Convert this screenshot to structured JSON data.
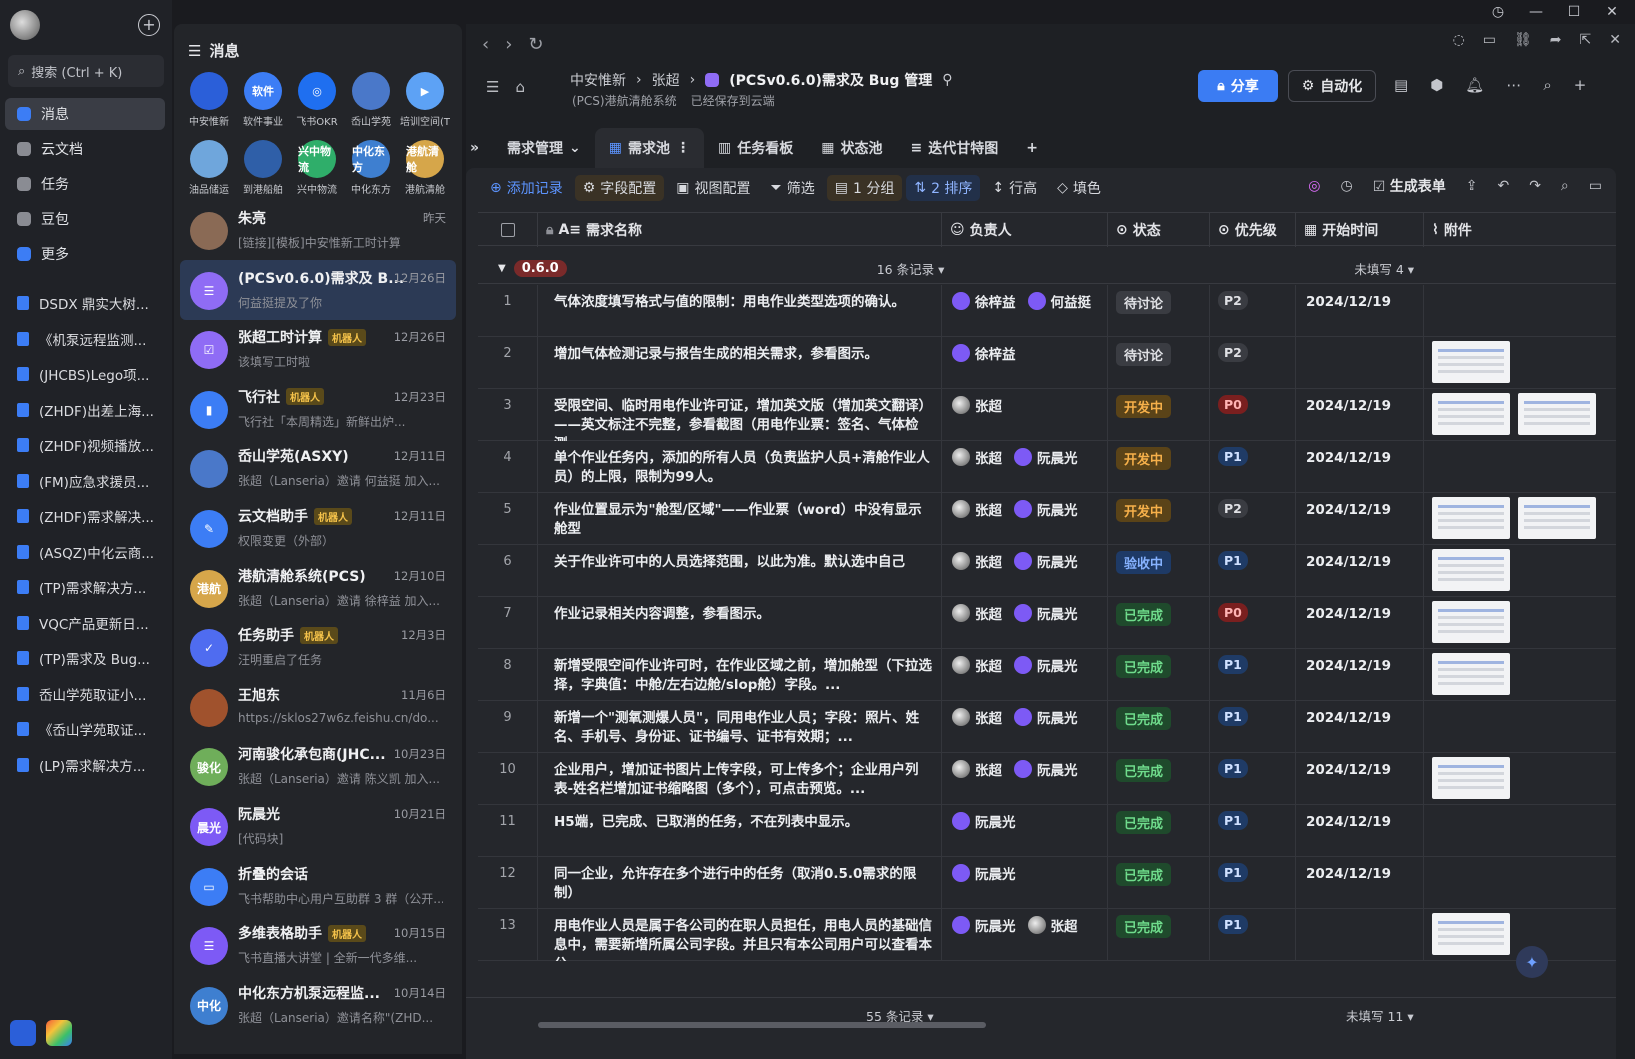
{
  "window_controls": [
    "◷",
    "—",
    "☐",
    "✕"
  ],
  "rail": {
    "search_placeholder": "搜索 (Ctrl + K)",
    "nav": [
      {
        "label": "消息",
        "color": "#3c7df5"
      },
      {
        "label": "云文档",
        "color": "#8a8c93"
      },
      {
        "label": "任务",
        "color": "#8a8c93"
      },
      {
        "label": "豆包",
        "color": "#8a8c93"
      },
      {
        "label": "更多",
        "color": "#3c7df5"
      }
    ],
    "docs": [
      "DSDX 鼎实大树...",
      "《机泵远程监测...",
      "(JHCBS)Lego项...",
      "(ZHDF)出差上海...",
      "(ZHDF)视频播放...",
      "(FM)应急求援员...",
      "(ZHDF)需求解决...",
      "(ASQZ)中化云商...",
      "(TP)需求解决方...",
      "VQC产品更新日...",
      "(TP)需求及 Bug...",
      "岙山学苑取证小...",
      "《岙山学苑取证...",
      "(LP)需求解决方..."
    ]
  },
  "messages": {
    "title": "消息",
    "apps": [
      {
        "label": "中安惟新",
        "text": "",
        "color": "#2b5fd9"
      },
      {
        "label": "软件事业",
        "text": "软件",
        "color": "#3c7df5"
      },
      {
        "label": "飞书OKR",
        "text": "◎",
        "color": "#1f6ff0"
      },
      {
        "label": "岙山学苑",
        "text": "",
        "color": "#4a78c9"
      },
      {
        "label": "培训空间(T",
        "text": "▶",
        "color": "#5da2f5"
      },
      {
        "label": "油品储运",
        "text": "",
        "color": "#6fa6dc"
      },
      {
        "label": "到港船舶",
        "text": "",
        "color": "#2f5fa8"
      },
      {
        "label": "兴中物流",
        "text": "兴中物流",
        "color": "#2fae6a"
      },
      {
        "label": "中化东方",
        "text": "中化东方",
        "color": "#3e7fd0"
      },
      {
        "label": "港航清舱",
        "text": "港航清舱",
        "color": "#d6a64a"
      }
    ],
    "conversations": [
      {
        "title": "朱亮",
        "bot": false,
        "time": "昨天",
        "sub": "[链接][模板]中安惟新工时计算",
        "avatar": "",
        "color": "#8a6a55"
      },
      {
        "title": "(PCSv0.6.0)需求及 B...",
        "bot": false,
        "time": "12月26日",
        "sub": "何益挺提及了你",
        "avatar": "☰",
        "color": "#8f6cf5"
      },
      {
        "title": "张超工时计算",
        "bot": true,
        "time": "12月26日",
        "sub": "该填写工时啦",
        "avatar": "☑",
        "color": "#8f6cf5"
      },
      {
        "title": "飞行社",
        "bot": true,
        "time": "12月23日",
        "sub": "飞行社「本周精选」新鲜出炉...",
        "avatar": "▮",
        "color": "#3c7df5"
      },
      {
        "title": "岙山学苑(ASXY)",
        "bot": false,
        "time": "12月11日",
        "sub": "张超（Lanseria）邀请 何益挺 加入...",
        "avatar": "",
        "color": "#4a78c9"
      },
      {
        "title": "云文档助手",
        "bot": true,
        "time": "12月11日",
        "sub": "权限变更（外部）",
        "avatar": "✎",
        "color": "#3c7df5"
      },
      {
        "title": "港航清舱系统(PCS)",
        "bot": false,
        "time": "12月10日",
        "sub": "张超（Lanseria）邀请 徐梓益 加入...",
        "avatar": "港航",
        "color": "#d6a64a"
      },
      {
        "title": "任务助手",
        "bot": true,
        "time": "12月3日",
        "sub": "汪明重启了任务",
        "avatar": "✓",
        "color": "#4f6cf0"
      },
      {
        "title": "王旭东",
        "bot": false,
        "time": "11月6日",
        "sub": "https://sklos27w6z.feishu.cn/do...",
        "avatar": "",
        "color": "#a0522d"
      },
      {
        "title": "河南骏化承包商(JHC...",
        "bot": false,
        "time": "10月23日",
        "sub": "张超（Lanseria）邀请 陈义凯 加入...",
        "avatar": "骏化",
        "color": "#6fae5a"
      },
      {
        "title": "阮晨光",
        "bot": false,
        "time": "10月21日",
        "sub": "[代码块]",
        "avatar": "晨光",
        "color": "#7d5af5"
      },
      {
        "title": "折叠的会话",
        "bot": false,
        "time": "",
        "sub": "飞书帮助中心用户互助群 3 群（公开...",
        "avatar": "▭",
        "color": "#3c7df5"
      },
      {
        "title": "多维表格助手",
        "bot": true,
        "time": "10月15日",
        "sub": "飞书直播大讲堂 | 全新一代多维...",
        "avatar": "☰",
        "color": "#7d5af5"
      },
      {
        "title": "中化东方机泵远程监...",
        "bot": false,
        "time": "10月14日",
        "sub": "张超（Lanseria）邀请名称\"(ZHD...",
        "avatar": "中化",
        "color": "#3e7fd0"
      }
    ]
  },
  "main": {
    "breadcrumb": [
      "中安惟新",
      "张超",
      "(PCSv0.6.0)需求及 Bug 管理"
    ],
    "sub_breadcrumb": [
      "(PCS)港航清舱系统",
      "已经保存到云端"
    ],
    "share": "分享",
    "automation": "自动化",
    "tabs": [
      "需求管理",
      "需求池",
      "任务看板",
      "状态池",
      "迭代甘特图"
    ],
    "toolbar": [
      "添加记录",
      "字段配置",
      "视图配置",
      "筛选",
      "1 分组",
      "2 排序",
      "行高",
      "填色"
    ],
    "toolbar_right": "生成表单",
    "columns": [
      "需求名称",
      "负责人",
      "状态",
      "优先级",
      "开始时间",
      "附件"
    ],
    "group": {
      "tag": "0.6.0",
      "count": "16 条记录",
      "unfilled": "未填写 4"
    },
    "footer": {
      "count": "55 条记录",
      "unfilled": "未填写 11"
    },
    "rows": [
      {
        "n": "1",
        "name": "气体浓度填写格式与值的限制：用电作业类型选项的确认。",
        "owners": [
          "徐梓益",
          "何益挺"
        ],
        "status": "待讨论",
        "prio": "P2",
        "date": "2024/12/19",
        "att": 0
      },
      {
        "n": "2",
        "name": "增加气体检测记录与报告生成的相关需求，参看图示。",
        "owners": [
          "徐梓益"
        ],
        "status": "待讨论",
        "prio": "P2",
        "date": "",
        "att": 1
      },
      {
        "n": "3",
        "name": "受限空间、临时用电作业许可证，增加英文版（增加英文翻译）——英文标注不完整，参看截图（用电作业票：签名、气体检测...",
        "owners": [
          "张超"
        ],
        "status": "开发中",
        "prio": "P0",
        "date": "2024/12/19",
        "att": 2
      },
      {
        "n": "4",
        "name": "单个作业任务内，添加的所有人员（负责监护人员+清舱作业人员）的上限，限制为99人。",
        "owners": [
          "张超",
          "阮晨光"
        ],
        "status": "开发中",
        "prio": "P1",
        "date": "2024/12/19",
        "att": 0
      },
      {
        "n": "5",
        "name": "作业位置显示为\"舱型/区域\"——作业票（word）中没有显示舱型",
        "owners": [
          "张超",
          "阮晨光"
        ],
        "status": "开发中",
        "prio": "P2",
        "date": "2024/12/19",
        "att": 2
      },
      {
        "n": "6",
        "name": "关于作业许可中的人员选择范围，以此为准。默认选中自己",
        "owners": [
          "张超",
          "阮晨光"
        ],
        "status": "验收中",
        "prio": "P1",
        "date": "2024/12/19",
        "att": 1
      },
      {
        "n": "7",
        "name": "作业记录相关内容调整，参看图示。",
        "owners": [
          "张超",
          "阮晨光"
        ],
        "status": "已完成",
        "prio": "P0",
        "date": "2024/12/19",
        "att": 1
      },
      {
        "n": "8",
        "name": "新增受限空间作业许可时，在作业区域之前，增加舱型（下拉选择，字典值：中舱/左右边舱/slop舱）字段。...",
        "owners": [
          "张超",
          "阮晨光"
        ],
        "status": "已完成",
        "prio": "P1",
        "date": "2024/12/19",
        "att": 1
      },
      {
        "n": "9",
        "name": "新增一个\"测氧测爆人员\"，同用电作业人员；字段：照片、姓名、手机号、身份证、证书编号、证书有效期；...",
        "owners": [
          "张超",
          "阮晨光"
        ],
        "status": "已完成",
        "prio": "P1",
        "date": "2024/12/19",
        "att": 0
      },
      {
        "n": "10",
        "name": "企业用户，增加证书图片上传字段，可上传多个；企业用户列表-姓名栏增加证书缩略图（多个），可点击预览。...",
        "owners": [
          "张超",
          "阮晨光"
        ],
        "status": "已完成",
        "prio": "P1",
        "date": "2024/12/19",
        "att": 1
      },
      {
        "n": "11",
        "name": "H5端，已完成、已取消的任务，不在列表中显示。",
        "owners": [
          "阮晨光"
        ],
        "status": "已完成",
        "prio": "P1",
        "date": "2024/12/19",
        "att": 0
      },
      {
        "n": "12",
        "name": "同一企业，允许存在多个进行中的任务（取消0.5.0需求的限制）",
        "owners": [
          "阮晨光"
        ],
        "status": "已完成",
        "prio": "P1",
        "date": "2024/12/19",
        "att": 0
      },
      {
        "n": "13",
        "name": "用电作业人员是属于各公司的在职人员担任，用电人员的基础信息中，需要新增所属公司字段。并且只有本公司用户可以查看本公...",
        "owners": [
          "阮晨光",
          "张超"
        ],
        "status": "已完成",
        "prio": "P1",
        "date": "",
        "att": 1
      }
    ]
  },
  "status_colors": {
    "待讨论": [
      "#3a3c42",
      "#e0e1e5"
    ],
    "开发中": [
      "#5a4318",
      "#f6b04a"
    ],
    "验收中": [
      "#1e3a66",
      "#86b2ff"
    ],
    "已完成": [
      "#1f4a2c",
      "#6fdc8c"
    ]
  },
  "prio_colors": {
    "P0": [
      "#7a1f1f",
      "#ffb3b3"
    ],
    "P1": [
      "#1f3b66",
      "#cfe0ff"
    ],
    "P2": [
      "#3a3c42",
      "#e0e1e5"
    ]
  }
}
